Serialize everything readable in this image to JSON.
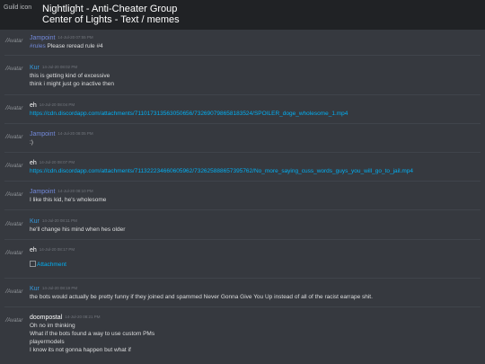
{
  "header": {
    "guild_icon_alt": "Guild icon",
    "guild_name": "Nightlight - Anti-Cheater Group",
    "channel": "Center of Lights - Text / memes"
  },
  "avatar_alt": "Avatar",
  "colors": {
    "Jampoint": "#7289da",
    "Kur": "#3498db",
    "eh": "#ffffff",
    "doompostal": "#ffffff"
  },
  "messages": [
    {
      "author": "Jampoint",
      "time": "14-Jul-20 07:55 PM",
      "lines": [
        {
          "mention": "#rules",
          "text": " Please reread rule #4"
        }
      ]
    },
    {
      "author": "Kur",
      "time": "14-Jul-20 08:02 PM",
      "lines": [
        {
          "text": "this is getting kind of excessive"
        },
        {
          "text": "think i might just go inactive then"
        }
      ]
    },
    {
      "author": "eh",
      "time": "14-Jul-20 08:04 PM",
      "lines": [
        {
          "link": "https://cdn.discordapp.com/attachments/711017313563050656/732690798658183524/SPOILER_doge_wholesome_1.mp4"
        }
      ]
    },
    {
      "author": "Jampoint",
      "time": "14-Jul-20 08:05 PM",
      "lines": [
        {
          "text": ":)"
        }
      ]
    },
    {
      "author": "eh",
      "time": "14-Jul-20 08:07 PM",
      "lines": [
        {
          "link": "https://cdn.discordapp.com/attachments/711322234660605962/732625888657395762/No_more_saying_cuss_words_guys_you_will_go_to_jail.mp4"
        }
      ]
    },
    {
      "author": "Jampoint",
      "time": "14-Jul-20 08:10 PM",
      "lines": [
        {
          "text": "I like this kid, he's wholesome"
        }
      ]
    },
    {
      "author": "Kur",
      "time": "14-Jul-20 08:11 PM",
      "lines": [
        {
          "text": "he'll change his mind when hes older"
        }
      ]
    },
    {
      "author": "eh",
      "time": "14-Jul-20 08:17 PM",
      "attachment": "Attachment",
      "lines": []
    },
    {
      "author": "Kur",
      "time": "14-Jul-20 08:19 PM",
      "lines": [
        {
          "text": "the bots would actually be pretty funny if they joined and spammed Never Gonna Give You Up instead of all of the racist earrape shit."
        }
      ]
    },
    {
      "author": "doompostal",
      "time": "14-Jul-20 08:21 PM",
      "lines": [
        {
          "text": "Oh no im thinking"
        },
        {
          "text": "What if the bots found a way to use custom PMs"
        },
        {
          "text": "playermodels"
        },
        {
          "text": "I know its not gonna happen but what if"
        }
      ]
    }
  ]
}
